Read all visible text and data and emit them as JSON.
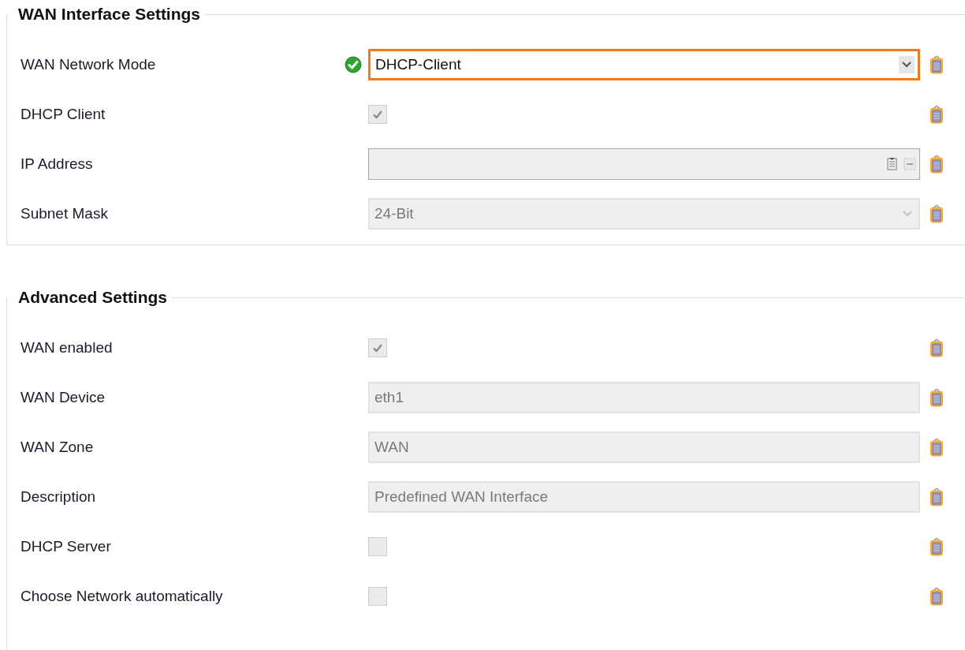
{
  "sections": [
    {
      "title": "WAN Interface Settings",
      "rows": [
        {
          "label": "WAN Network Mode",
          "kind": "select",
          "value": "DHCP-Client",
          "disabled": false,
          "focused": true,
          "valid": true
        },
        {
          "label": "DHCP Client",
          "kind": "checkbox",
          "checked": true,
          "disabled": true
        },
        {
          "label": "IP Address",
          "kind": "address",
          "disabled": true
        },
        {
          "label": "Subnet Mask",
          "kind": "select",
          "value": "24-Bit",
          "disabled": true,
          "focused": false
        }
      ]
    },
    {
      "title": "Advanced Settings",
      "rows": [
        {
          "label": "WAN enabled",
          "kind": "checkbox",
          "checked": true,
          "disabled": true
        },
        {
          "label": "WAN Device",
          "kind": "text",
          "value": "eth1",
          "disabled": true
        },
        {
          "label": "WAN Zone",
          "kind": "text",
          "value": "WAN",
          "disabled": true
        },
        {
          "label": "Description",
          "kind": "text",
          "value": "Predefined WAN Interface",
          "disabled": true
        },
        {
          "label": "DHCP Server",
          "kind": "checkbox",
          "checked": false,
          "disabled": true
        },
        {
          "label": "Choose Network automatically",
          "kind": "checkbox",
          "checked": false,
          "disabled": true
        }
      ]
    }
  ]
}
